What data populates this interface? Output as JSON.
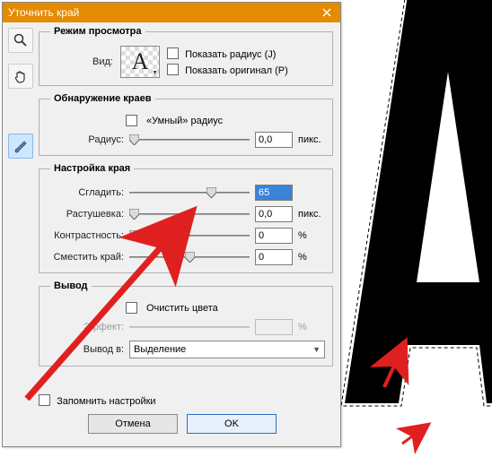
{
  "window": {
    "title": "Уточнить край"
  },
  "view_mode": {
    "legend": "Режим просмотра",
    "view_label": "Вид:",
    "preview_letter": "A",
    "show_radius_label": "Показать радиус (J)",
    "show_original_label": "Показать оригинал (P)"
  },
  "edge_detection": {
    "legend": "Обнаружение краев",
    "smart_radius_label": "«Умный» радиус",
    "radius_label": "Радиус:",
    "radius_value": "0,0",
    "radius_unit": "пикс."
  },
  "edge_adjust": {
    "legend": "Настройка края",
    "smooth_label": "Сгладить:",
    "smooth_value": "65",
    "feather_label": "Растушевка:",
    "feather_value": "0,0",
    "feather_unit": "пикс.",
    "contrast_label": "Контрастность:",
    "contrast_value": "0",
    "contrast_unit": "%",
    "shift_label": "Сместить край:",
    "shift_value": "0",
    "shift_unit": "%"
  },
  "output": {
    "legend": "Вывод",
    "decontaminate_label": "Очистить цвета",
    "effect_label": "Эффект:",
    "effect_unit": "%",
    "output_to_label": "Вывод в:",
    "output_to_value": "Выделение"
  },
  "footer": {
    "remember_label": "Запомнить настройки",
    "cancel": "Отмена",
    "ok": "OK"
  }
}
